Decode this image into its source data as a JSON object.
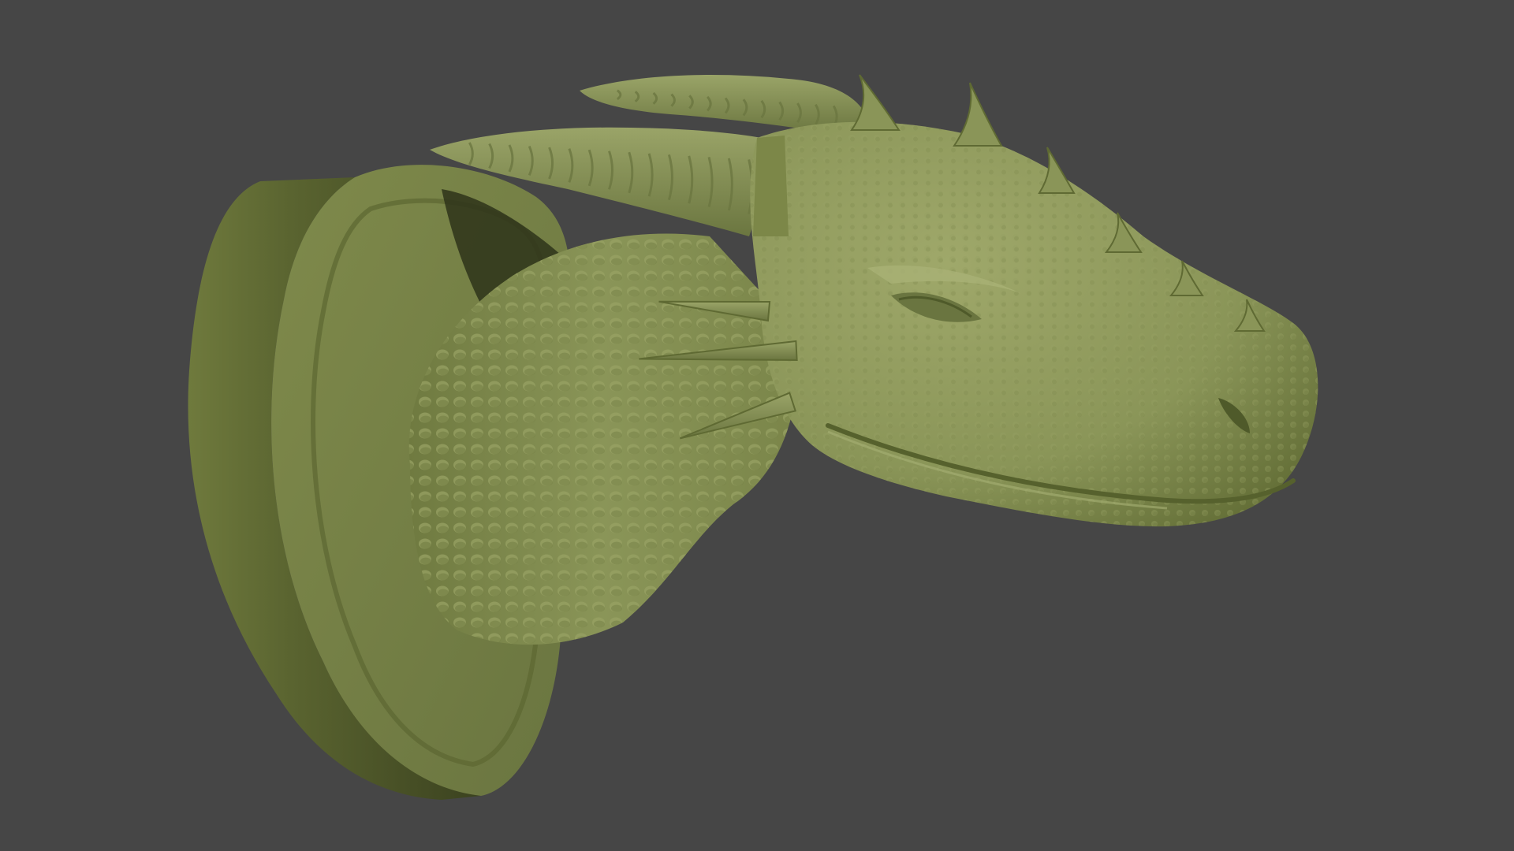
{
  "scene": {
    "background_color": "#464646",
    "model": {
      "subject": "mounted-dragon-head-sculpt",
      "material_color": "#8a9558",
      "shadow_color": "#3f4620",
      "highlight_color": "#a7b074"
    }
  }
}
